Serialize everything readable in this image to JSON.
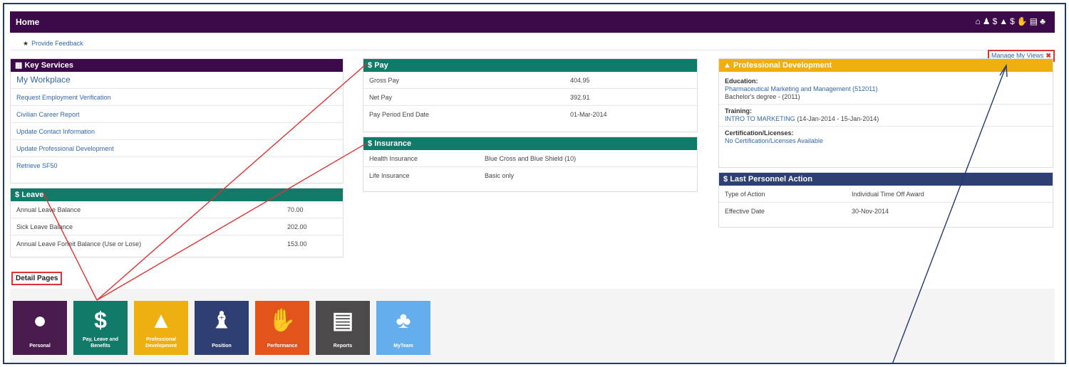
{
  "topbar": {
    "title": "Home"
  },
  "feedback": {
    "label": "Provide Feedback"
  },
  "manage_views": {
    "label": "Manage My Views"
  },
  "key_services": {
    "title": "Key Services",
    "workplace": "My Workplace",
    "links": [
      "Request Employment Verification",
      "Civilian Career Report",
      "Update Contact Information",
      "Update Professional Development",
      "Retrieve SF50"
    ]
  },
  "leave": {
    "title": "Leave",
    "rows": [
      {
        "label": "Annual Leave Balance",
        "value": "70.00"
      },
      {
        "label": "Sick Leave Balance",
        "value": "202.00"
      },
      {
        "label": "Annual Leave Forfeit Balance (Use or Lose)",
        "value": "153.00"
      }
    ]
  },
  "pay": {
    "title": "Pay",
    "rows": [
      {
        "label": "Gross Pay",
        "value": "404.95"
      },
      {
        "label": "Net Pay",
        "value": "392.91"
      },
      {
        "label": "Pay Period End Date",
        "value": "01-Mar-2014"
      }
    ]
  },
  "insurance": {
    "title": "Insurance",
    "rows": [
      {
        "label": "Health Insurance",
        "value": "Blue Cross and Blue Shield (10)"
      },
      {
        "label": "Life Insurance",
        "value": "Basic only"
      }
    ]
  },
  "profdev": {
    "title": "Professional Development",
    "education_label": "Education:",
    "education_link": "Pharmaceutical Marketing and Management (512011)",
    "education_degree": "Bachelor's degree - (2011)",
    "training_label": "Training:",
    "training_link": "INTRO TO MARKETING",
    "training_dates": "(14-Jan-2014 - 15-Jan-2014)",
    "cert_label": "Certification/Licenses:",
    "cert_link": "No Certification/Licenses Available"
  },
  "last_action": {
    "title": "Last Personnel Action",
    "rows": [
      {
        "label": "Type of Action",
        "value": "Individual Time Off Award"
      },
      {
        "label": "Effective Date",
        "value": "30-Nov-2014"
      }
    ]
  },
  "detail_pages": {
    "label": "Detail Pages",
    "tiles": [
      {
        "label": "Personal",
        "icon": "person-icon",
        "color": "#4a1b4d"
      },
      {
        "label": "Pay, Leave and Benefits",
        "icon": "dollar-icon",
        "color": "#127a68"
      },
      {
        "label": "Professional Development",
        "icon": "graduation-cap-icon",
        "color": "#eeb011"
      },
      {
        "label": "Position",
        "icon": "position-icon",
        "color": "#2e3f73"
      },
      {
        "label": "Performance",
        "icon": "thumbs-up-icon",
        "color": "#e2541b"
      },
      {
        "label": "Reports",
        "icon": "document-icon",
        "color": "#4d4a4b"
      },
      {
        "label": "MyTeam",
        "icon": "org-chart-icon",
        "color": "#65aeee"
      }
    ]
  },
  "colors": {
    "purple": "#3c0a49",
    "green": "#127a68",
    "gold": "#eeb011",
    "navy": "#2e3f73",
    "link": "#3467a8",
    "annotation_red": "#dd3333",
    "annotation_blue": "#1f3b74"
  }
}
